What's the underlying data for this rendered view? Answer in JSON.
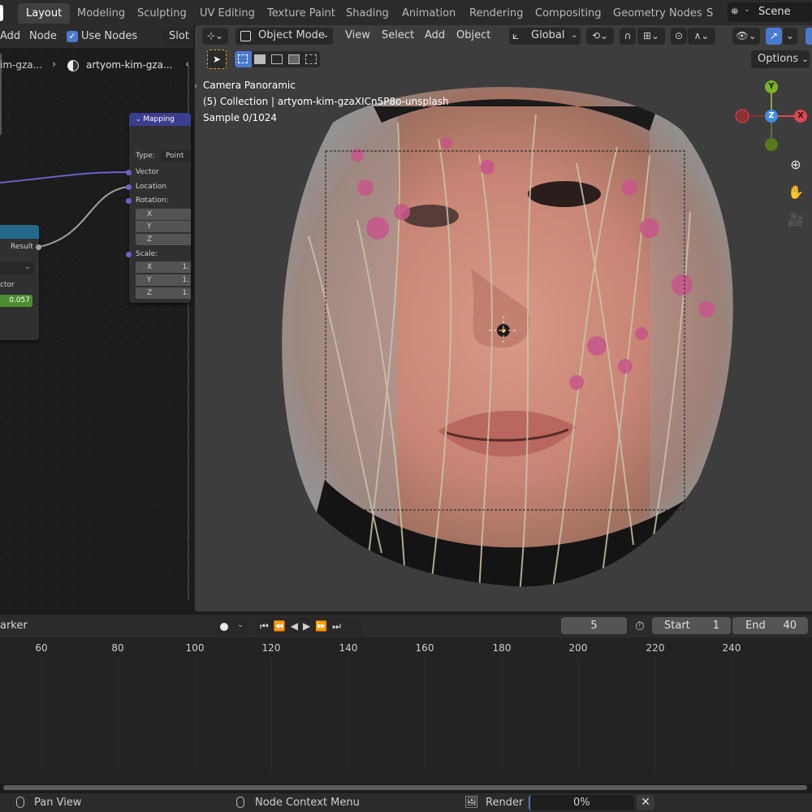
{
  "topbar": {
    "tabs": [
      "Layout",
      "Modeling",
      "Sculpting",
      "UV Editing",
      "Texture Paint",
      "Shading",
      "Animation",
      "Rendering",
      "Compositing",
      "Geometry Nodes",
      "S"
    ],
    "active_tab": "Layout",
    "scene_name": "Scene"
  },
  "node_editor": {
    "menu_add": "Add",
    "menu_node": "Node",
    "use_nodes_label": "Use Nodes",
    "slot_label": "Slot",
    "breadcrumb_item": "im-gza...",
    "breadcrumb_material": "artyom-kim-gza...",
    "mapping_node": {
      "title": "Mapping",
      "type_label": "Type:",
      "type_value": "Point",
      "vector_label": "Vector",
      "location_label": "Location",
      "rotation_label": "Rotation:",
      "rotation_axes": [
        "X",
        "Y",
        "Z"
      ],
      "scale_label": "Scale:",
      "scale_axes": [
        "X",
        "Y",
        "Z"
      ],
      "scale_values": [
        "1.",
        "1.",
        "1."
      ]
    },
    "left_node": {
      "result_label": "Result",
      "vector_label": "ctor",
      "value": "0.057"
    }
  },
  "viewport": {
    "mode": "Object Mode",
    "menus": [
      "View",
      "Select",
      "Add",
      "Object"
    ],
    "orientation": "Global",
    "options_label": "Options",
    "overlay_line1": "Camera Panoramic",
    "overlay_line2": "(5) Collection | artyom-kim-gzaXICn5P8o-unsplash",
    "overlay_line3": "Sample 0/1024",
    "gizmo": {
      "y": "Y",
      "z": "Z",
      "x": "X"
    }
  },
  "timeline": {
    "marker_label": "arker",
    "current_frame": "5",
    "start_label": "Start",
    "start_value": "1",
    "end_label": "End",
    "end_value": "40",
    "frame_ticks": [
      "60",
      "80",
      "100",
      "120",
      "140",
      "160",
      "180",
      "200",
      "220",
      "240"
    ]
  },
  "statusbar": {
    "pan_view": "Pan View",
    "node_context_menu": "Node Context Menu",
    "render_label": "Render",
    "render_progress": "0%",
    "render_progress_fraction": 0.0
  },
  "colors": {
    "accent_blue": "#4a7ad0",
    "mapping_header": "#3b3e8f",
    "axis_x": "#e0464f",
    "axis_y": "#7bb320",
    "axis_z": "#3f8ee6",
    "value_green": "#4b8f2f"
  }
}
